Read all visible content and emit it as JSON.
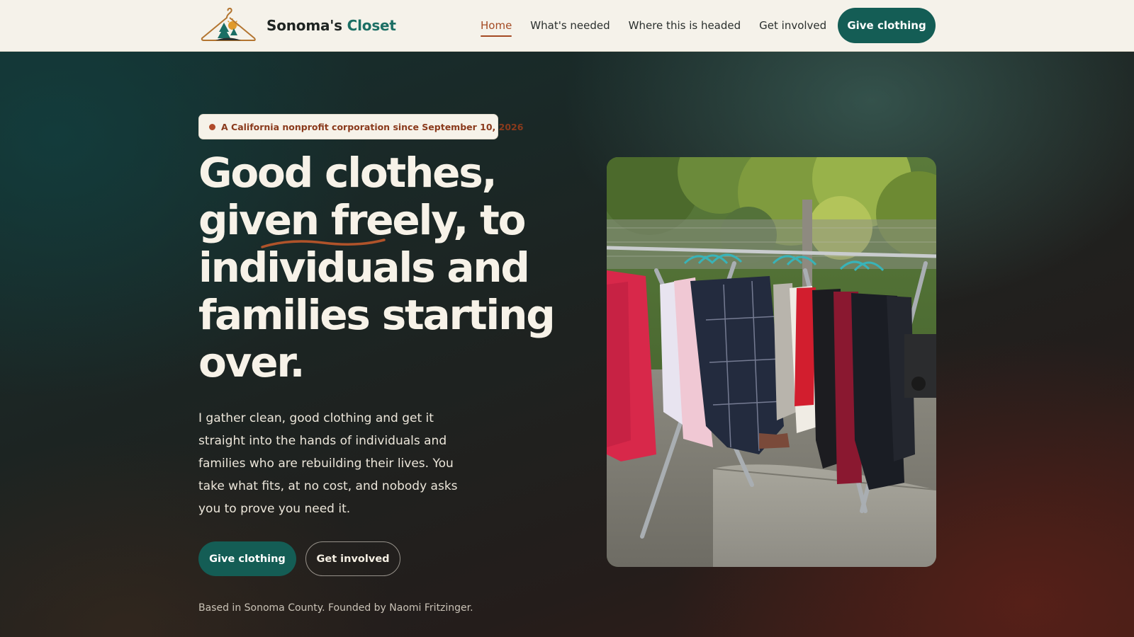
{
  "brand": {
    "name_main": "Sonoma's",
    "name_accent": "Closet",
    "logo_icon": "hanger-tree-sun-logo"
  },
  "nav": {
    "items": [
      {
        "label": "Home",
        "active": true
      },
      {
        "label": "What's needed"
      },
      {
        "label": "Where this is headed"
      },
      {
        "label": "Get involved"
      }
    ],
    "cta_label": "Give clothing"
  },
  "hero": {
    "badge": "A California nonprofit corporation since September 10, 2026",
    "headline_lines": [
      "Good clothes,",
      "given freely, to",
      "individuals and",
      "families starting",
      "over."
    ],
    "lede": "I gather clean, good clothing and get it straight into the hands of individuals and families who are rebuilding their lives. You take what fits, at no cost, and nobody asks you to prove you need it.",
    "primary_cta": "Give clothing",
    "secondary_cta": "Get involved",
    "footnote": "Based in Sonoma County. Founded by Naomi Fritzinger.",
    "photo": "clothing-rack-photo"
  },
  "colors": {
    "accent_teal": "#145d55",
    "accent_rust": "#a44a23",
    "cream": "#f5f2ea",
    "headline_text": "#f7f2e8"
  }
}
